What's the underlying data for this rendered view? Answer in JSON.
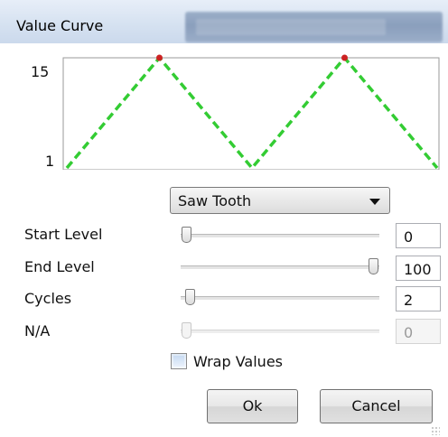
{
  "window": {
    "title": "Value Curve"
  },
  "curve": {
    "y_max_label": "15",
    "y_min_label": "1",
    "line_color": "#33cc33",
    "peak_marker_color": "#cc2222"
  },
  "curve_type": {
    "selected": "Saw Tooth"
  },
  "sliders": [
    {
      "label": "Start Level",
      "value": "0",
      "fraction": 0.03,
      "enabled": true
    },
    {
      "label": "End Level",
      "value": "100",
      "fraction": 0.97,
      "enabled": true
    },
    {
      "label": "Cycles",
      "value": "2",
      "fraction": 0.05,
      "enabled": true
    },
    {
      "label": "N/A",
      "value": "0",
      "fraction": 0.03,
      "enabled": false
    }
  ],
  "wrap_values": {
    "label": "Wrap Values",
    "checked": false
  },
  "buttons": {
    "ok": "Ok",
    "cancel": "Cancel"
  }
}
